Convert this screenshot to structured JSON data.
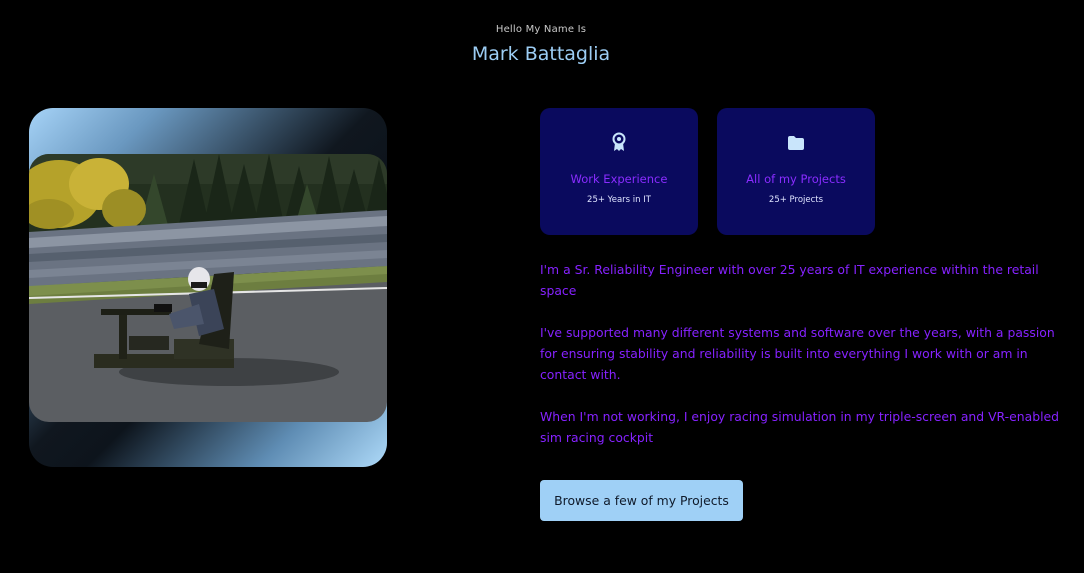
{
  "header": {
    "greeting": "Hello My Name Is",
    "name": "Mark Battaglia"
  },
  "photo": {
    "alt": "Sim racing cockpit on a race track"
  },
  "cards": [
    {
      "icon": "award-ribbon-icon",
      "title": "Work Experience",
      "subtitle": "25+ Years in IT"
    },
    {
      "icon": "folder-icon",
      "title": "All of my Projects",
      "subtitle": "25+ Projects"
    }
  ],
  "about": {
    "paragraph_1": "I'm a Sr. Reliability Engineer with over 25 years of IT experience within the retail space",
    "paragraph_2": "I've supported many different systems and software over the years, with a passion for ensuring stability and reliability is built into everything I work with or am in contact with.",
    "paragraph_3": "When I'm not working, I enjoy racing simulation in my triple-screen and VR-enabled sim racing cockpit"
  },
  "cta": {
    "label": "Browse a few of my Projects"
  },
  "colors": {
    "background": "#000000",
    "accent_blue": "#9ccdf4",
    "accent_purple": "#8622ff",
    "card_bg": "#0a0a5e",
    "button_bg": "#9fd0f6"
  }
}
